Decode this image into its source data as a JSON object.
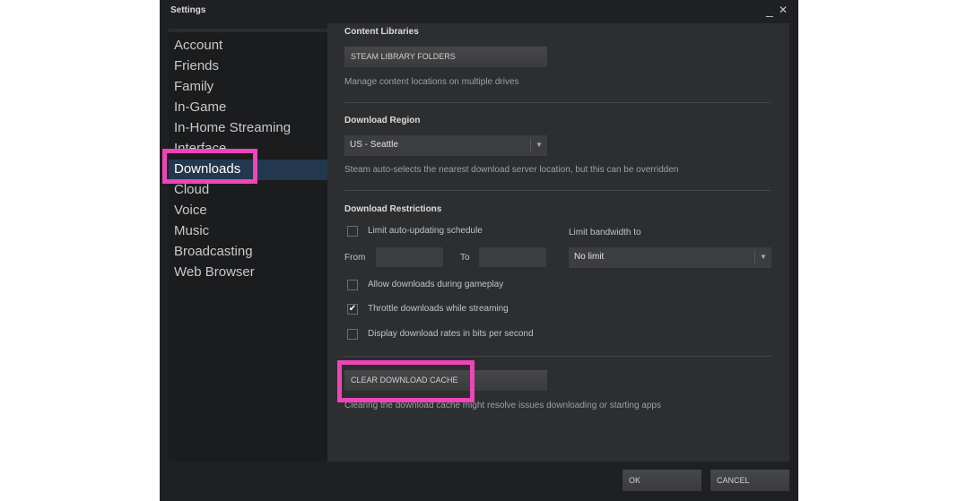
{
  "window": {
    "title": "Settings",
    "minimize": "_",
    "close": "✕"
  },
  "sidebar": {
    "items": [
      {
        "label": "Account"
      },
      {
        "label": "Friends"
      },
      {
        "label": "Family"
      },
      {
        "label": "In-Game"
      },
      {
        "label": "In-Home Streaming"
      },
      {
        "label": "Interface"
      },
      {
        "label": "Downloads",
        "selected": true
      },
      {
        "label": "Cloud"
      },
      {
        "label": "Voice"
      },
      {
        "label": "Music"
      },
      {
        "label": "Broadcasting"
      },
      {
        "label": "Web Browser"
      }
    ]
  },
  "content": {
    "libraries": {
      "heading": "Content Libraries",
      "button": "STEAM LIBRARY FOLDERS",
      "desc": "Manage content locations on multiple drives"
    },
    "region": {
      "heading": "Download Region",
      "value": "US - Seattle",
      "desc": "Steam auto-selects the nearest download server location, but this can be overridden"
    },
    "restrictions": {
      "heading": "Download Restrictions",
      "schedule_label": "Limit auto-updating schedule",
      "schedule_checked": false,
      "from_label": "From",
      "from_value": "",
      "to_label": "To",
      "to_value": "",
      "bandwidth_label": "Limit bandwidth to",
      "bandwidth_value": "No limit",
      "options": [
        {
          "label": "Allow downloads during gameplay",
          "checked": false
        },
        {
          "label": "Throttle downloads while streaming",
          "checked": true
        },
        {
          "label": "Display download rates in bits per second",
          "checked": false
        }
      ]
    },
    "cache": {
      "button": "CLEAR DOWNLOAD CACHE",
      "desc": "Clearing the download cache might resolve issues downloading or starting apps"
    }
  },
  "footer": {
    "ok": "OK",
    "cancel": "CANCEL"
  },
  "colors": {
    "highlight": "#ee45b8",
    "selected": "#23384f"
  }
}
